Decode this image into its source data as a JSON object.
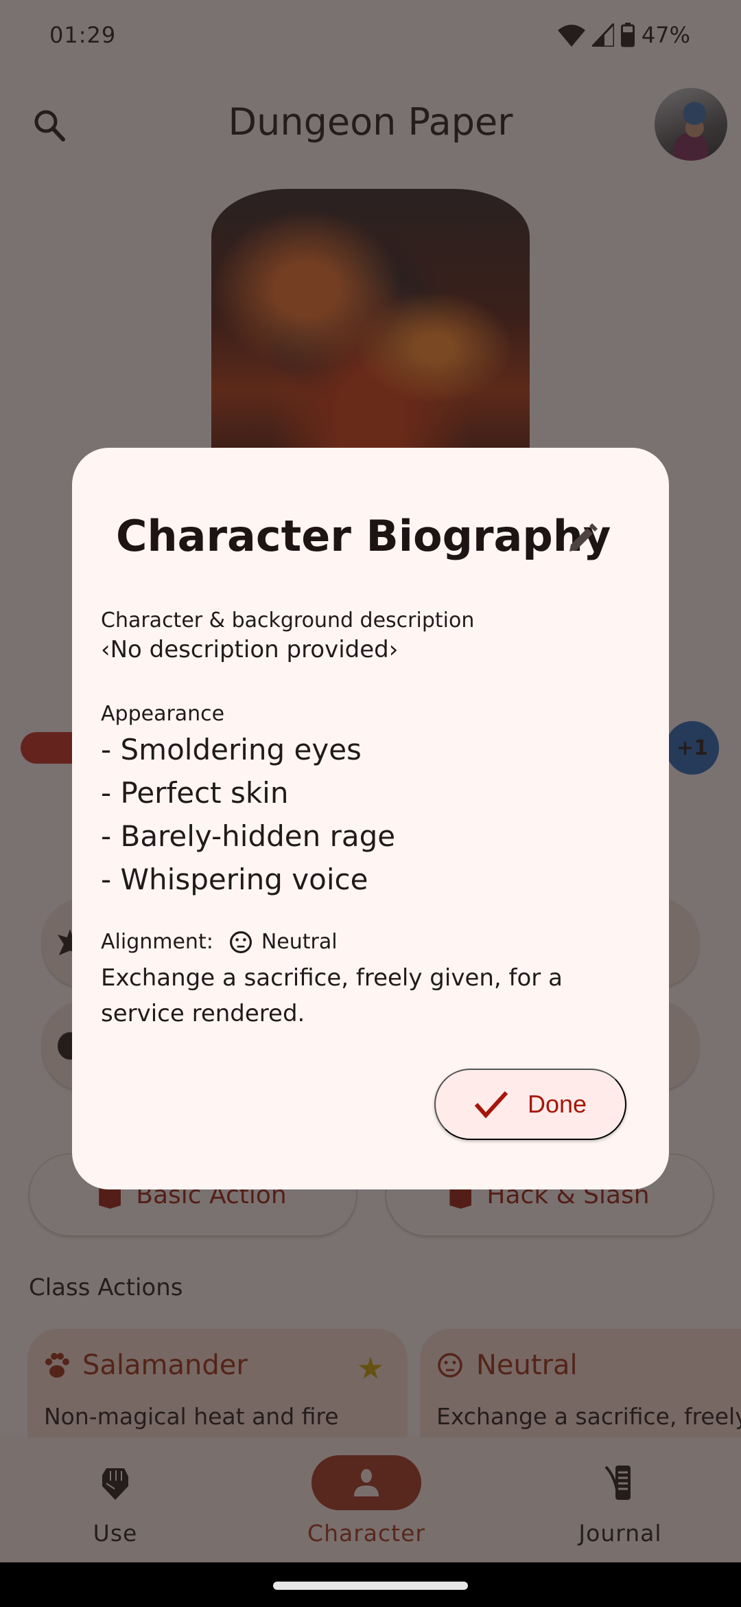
{
  "status_bar": {
    "time": "01:29",
    "battery_percent": "47%",
    "icons": [
      "wifi-icon",
      "cell-signal-icon",
      "battery-icon"
    ]
  },
  "app_bar": {
    "title": "Dungeon Paper",
    "search_icon": "search-icon",
    "avatar": "user-avatar"
  },
  "background": {
    "xp_badge": "+1",
    "actions": [
      "Basic Action",
      "Hack & Slash"
    ],
    "class_actions_title": "Class Actions",
    "class_cards": [
      {
        "title": "Salamander",
        "icon": "paw-icon",
        "starred": true,
        "description": "Non-magical heat and fire cannot harm you"
      },
      {
        "title": "Neutral",
        "icon": "neutral-face-icon",
        "starred": false,
        "description": "Exchange a sacrifice, freely given, for a service rendered"
      }
    ]
  },
  "dialog": {
    "title": "Character Biography",
    "edit_icon": "pencil-icon",
    "description_label": "Character & background description",
    "description_value": "‹No description provided›",
    "appearance_label": "Appearance",
    "appearance_items": [
      "- Smoldering eyes",
      "- Perfect skin",
      "- Barely-hidden rage",
      "- Whispering voice"
    ],
    "alignment_label": "Alignment:",
    "alignment_value": "Neutral",
    "alignment_icon": "neutral-face-icon",
    "alignment_description": "Exchange a sacrifice, freely given, for a service rendered.",
    "done_label": "Done"
  },
  "bottom_nav": {
    "items": [
      {
        "label": "Use",
        "icon": "fist-icon",
        "active": false
      },
      {
        "label": "Character",
        "icon": "person-icon",
        "active": true
      },
      {
        "label": "Journal",
        "icon": "quill-scroll-icon",
        "active": false
      }
    ]
  },
  "colors": {
    "primary": "#a5341b",
    "done_text": "#a5160a",
    "dialog_bg": "#fff6f4",
    "xp_badge": "#2466b8",
    "star": "#c9a400"
  }
}
